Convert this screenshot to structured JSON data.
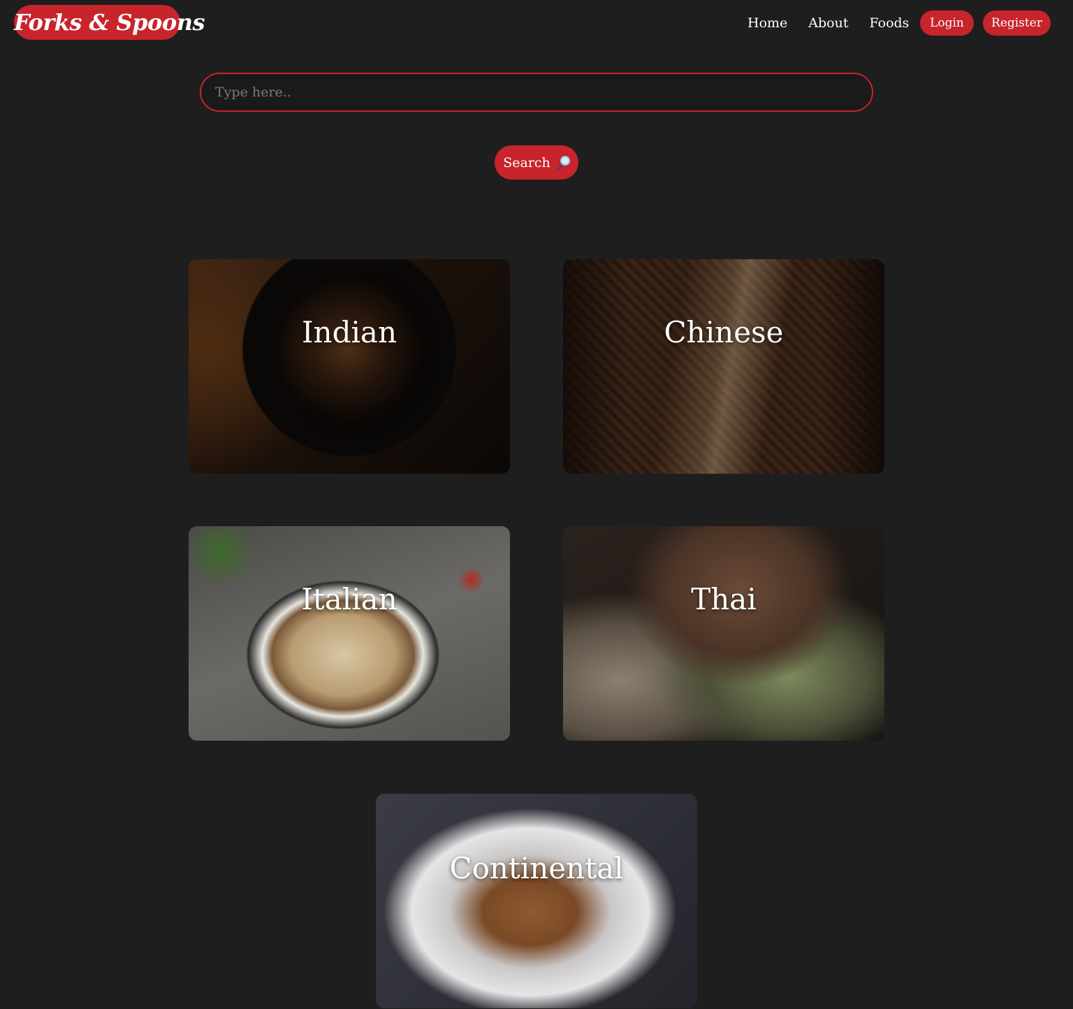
{
  "brand": {
    "name": "Forks & Spoons"
  },
  "nav": {
    "links": [
      "Home",
      "About",
      "Foods"
    ],
    "login_label": "Login",
    "register_label": "Register"
  },
  "search": {
    "placeholder": "Type here..",
    "value": "",
    "button_label": "Search",
    "icon": "magnifying-glass-icon"
  },
  "categories": [
    {
      "name": "Indian"
    },
    {
      "name": "Chinese"
    },
    {
      "name": "Italian"
    },
    {
      "name": "Thai"
    },
    {
      "name": "Continental"
    }
  ],
  "colors": {
    "background": "#1e1e1e",
    "accent": "#c8242b",
    "text": "#ffffff",
    "placeholder": "#7a7a7a"
  }
}
